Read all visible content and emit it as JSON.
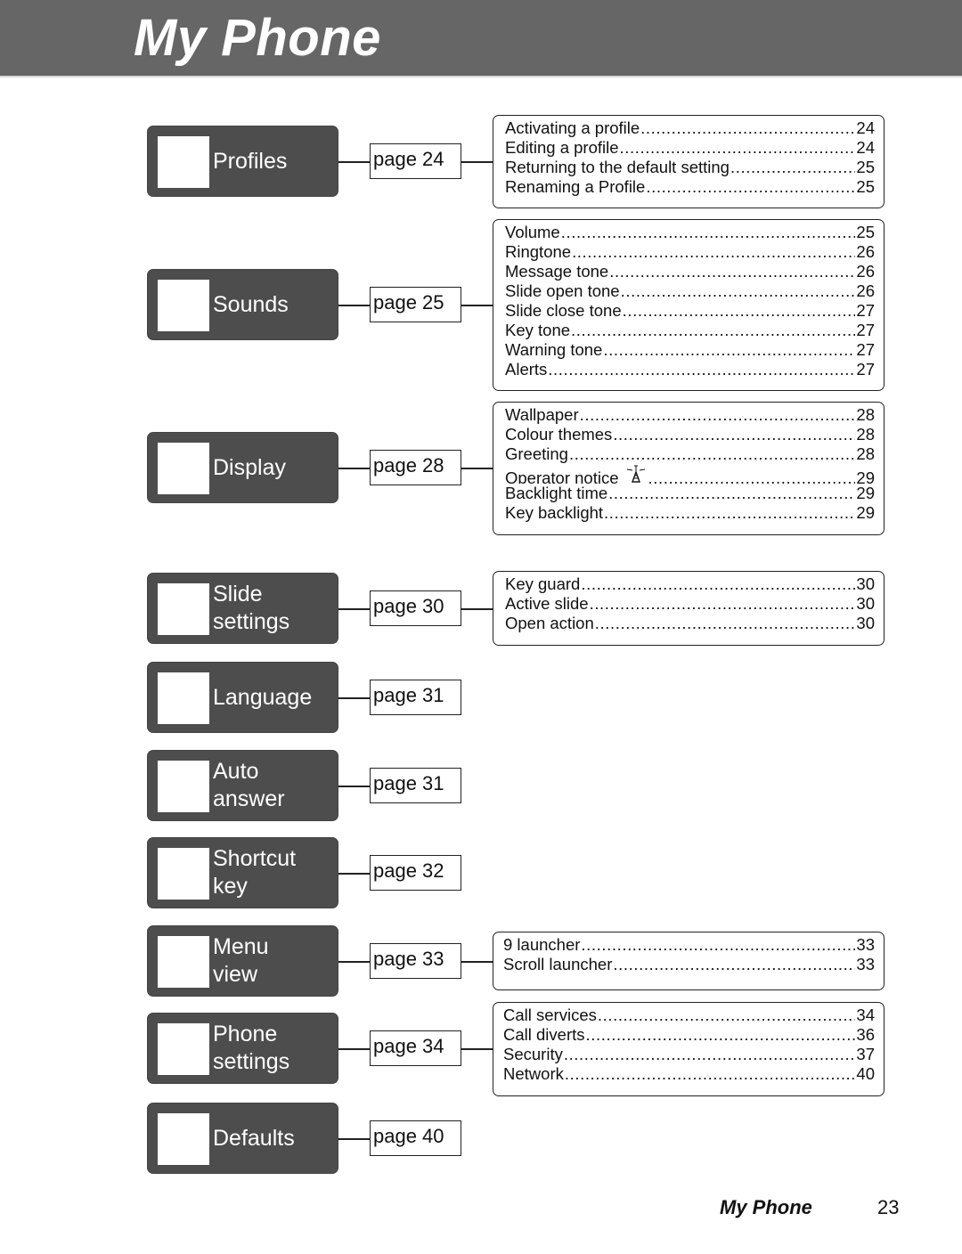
{
  "header": {
    "title": "My Phone"
  },
  "menu": [
    {
      "id": "profiles",
      "label": "Profiles",
      "page": "page 24"
    },
    {
      "id": "sounds",
      "label": "Sounds",
      "page": "page 25"
    },
    {
      "id": "display",
      "label": "Display",
      "page": "page 28"
    },
    {
      "id": "slide-settings",
      "label": "Slide\nsettings",
      "page": "page 30"
    },
    {
      "id": "language",
      "label": "Language",
      "page": "page 31"
    },
    {
      "id": "auto-answer",
      "label": "Auto\nanswer",
      "page": "page 31"
    },
    {
      "id": "shortcut-key",
      "label": "Shortcut\nkey",
      "page": "page 32"
    },
    {
      "id": "menu-view",
      "label": "Menu\nview",
      "page": "page 33"
    },
    {
      "id": "phone-settings",
      "label": "Phone\nsettings",
      "page": "page 34"
    },
    {
      "id": "defaults",
      "label": "Defaults",
      "page": "page 40"
    }
  ],
  "toc": {
    "profiles": [
      {
        "label": "Activating a profile",
        "page": "24"
      },
      {
        "label": "Editing a profile",
        "page": "24"
      },
      {
        "label": "Returning to the default setting",
        "page": "25"
      },
      {
        "label": "Renaming a Profile",
        "page": "25"
      }
    ],
    "sounds": [
      {
        "label": "Volume",
        "page": "25"
      },
      {
        "label": "Ringtone",
        "page": "26"
      },
      {
        "label": "Message tone",
        "page": "26"
      },
      {
        "label": "Slide open tone",
        "page": "26"
      },
      {
        "label": "Slide close tone",
        "page": "27"
      },
      {
        "label": "Key tone",
        "page": "27"
      },
      {
        "label": "Warning tone",
        "page": "27"
      },
      {
        "label": "Alerts",
        "page": "27"
      }
    ],
    "display": [
      {
        "label": "Wallpaper",
        "page": "28"
      },
      {
        "label": "Colour themes",
        "page": "28"
      },
      {
        "label": "Greeting",
        "page": "28"
      },
      {
        "label": "Operator notice",
        "page": "29",
        "icon": "antenna-icon"
      },
      {
        "label": "Backlight time",
        "page": "29"
      },
      {
        "label": "Key backlight",
        "page": "29"
      }
    ],
    "slide_settings": [
      {
        "label": "Key guard",
        "page": "30"
      },
      {
        "label": "Active slide",
        "page": "30"
      },
      {
        "label": "Open action",
        "page": "30"
      }
    ],
    "menu_view": [
      {
        "label": "9 launcher",
        "page": "33"
      },
      {
        "label": "Scroll launcher",
        "page": "33"
      }
    ],
    "phone_settings": [
      {
        "label": "Call services",
        "page": "34"
      },
      {
        "label": "Call diverts",
        "page": "36"
      },
      {
        "label": "Security",
        "page": "37"
      },
      {
        "label": "Network",
        "page": "40"
      }
    ]
  },
  "footer": {
    "title": "My Phone",
    "page_number": "23"
  }
}
